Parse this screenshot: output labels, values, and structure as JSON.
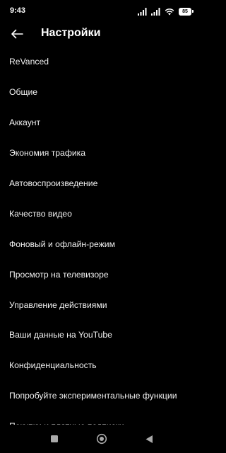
{
  "status_bar": {
    "time": "9:43",
    "battery_level": "85",
    "icons": [
      "signal-icon",
      "signal-icon",
      "wifi-icon",
      "battery-icon"
    ]
  },
  "app_bar": {
    "back_icon": "arrow-left-icon",
    "title": "Настройки"
  },
  "settings": {
    "items": [
      {
        "label": "ReVanced"
      },
      {
        "label": "Общие"
      },
      {
        "label": "Аккаунт"
      },
      {
        "label": "Экономия трафика"
      },
      {
        "label": "Автовоспроизведение"
      },
      {
        "label": "Качество видео"
      },
      {
        "label": "Фоновый и офлайн-режим"
      },
      {
        "label": "Просмотр на телевизоре"
      },
      {
        "label": "Управление действиями"
      },
      {
        "label": "Ваши данные на YouTube"
      },
      {
        "label": "Конфиденциальность"
      },
      {
        "label": "Попробуйте экспериментальные функции"
      },
      {
        "label": "Покупки и платные подписки"
      }
    ]
  },
  "nav_bar": {
    "buttons": [
      "recents-square-icon",
      "home-circle-icon",
      "back-triangle-icon"
    ]
  },
  "colors": {
    "background": "#000000",
    "text": "#f1f1f1",
    "icon": "#aaaaaa"
  }
}
